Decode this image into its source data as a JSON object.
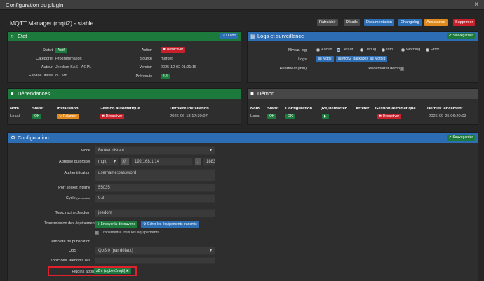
{
  "window": {
    "title": "Configuration du plugin",
    "close": "×"
  },
  "page_title": "MQTT Manager (mqtt2) - stable",
  "toolbar": [
    {
      "label": "Rafraichir",
      "color": "#4a4a4a"
    },
    {
      "label": "Détails",
      "color": "#4a4a4a"
    },
    {
      "label": "Documentation",
      "color": "#2c6db4"
    },
    {
      "label": "Changelog",
      "color": "#2c6db4"
    },
    {
      "label": "Assistance",
      "color": "#e08a1e"
    },
    {
      "label": "Supprimer",
      "color": "#c8202a"
    }
  ],
  "etat": {
    "title": "Etat",
    "open_button": "Ouvrir",
    "statut_label": "Statut",
    "statut_value": "Actif",
    "categorie_label": "Catégorie",
    "categorie_value": "Programmation",
    "auteur_label": "Auteur",
    "auteur_value": "Jeedom SAS - AGPL",
    "espace_label": "Espace utilisé",
    "espace_value": "8.7 MB",
    "action_label": "Action",
    "action_button": "Désactiver",
    "source_label": "Source",
    "source_value": "market",
    "version_label": "Version",
    "version_value": "2025-12-02 01:21:15",
    "prerequis_label": "Prérequis",
    "prerequis_value": "4.4"
  },
  "logs": {
    "title": "Logs et surveillance",
    "save": "Sauvegarder",
    "niveau_label": "Niveau log",
    "levels": [
      "Aucun",
      "Defaut",
      "Debug",
      "Info",
      "Warning",
      "Error"
    ],
    "logs_label": "Logs",
    "log_buttons": [
      "Mqtt2",
      "Mqtt2_packages",
      "Mqtt2d"
    ],
    "heartbeat_label": "Heartbeat (min)",
    "restart_label": "Redémarrer démon"
  },
  "deps": {
    "title": "Dépendances",
    "headers": [
      "Nom",
      "Statut",
      "Installation",
      "Gestion automatique",
      "Dernière installation"
    ],
    "row": {
      "nom": "Local",
      "statut": "OK",
      "install": "Relancer",
      "gestion": "Désactiver",
      "derniere": "2026-06-18 17:30:07"
    }
  },
  "demon": {
    "title": "Démon",
    "headers": [
      "Nom",
      "Statut",
      "Configuration",
      "(Re)Démarrer",
      "Arrêter",
      "Gestion automatique",
      "Dernier lancement"
    ],
    "row": {
      "nom": "Local",
      "statut": "OK",
      "config": "OK",
      "gestion": "Désactiver",
      "dernier": "2026-09-25 06:20:03"
    }
  },
  "config": {
    "title": "Configuration",
    "save": "Sauvegarder",
    "mode_label": "Mode",
    "mode_value": "Broker distant",
    "broker_label": "Adresse du broker",
    "broker_proto": "mqtt",
    "broker_sep": "://",
    "broker_host": "192.168.1.14",
    "broker_colon": ":",
    "broker_port": "1883",
    "auth_label": "Authentification",
    "auth_value": "username:password",
    "socket_label": "Port socket interne",
    "socket_value": "55035",
    "cycle_label": "Cycle",
    "cycle_unit": "(secondes)",
    "cycle_value": "0.3",
    "topic_label": "Topic racine Jeedom",
    "topic_value": "jeedom",
    "trans_label": "Transmission des équipements",
    "send_discovery": "Envoyer la découverte",
    "manage_transmitted": "Gérer les équipements transmis",
    "transmit_all": "Transmettre tous les équipements",
    "template_label": "Template de publication",
    "qos_label": "QoS",
    "qos_value": "QoS 0 (par défaut)",
    "linked_label": "Topic des Jeedoms liés",
    "plugins_label": "Plugins abonnés",
    "plugins_tag": "z2m (zigbee2mqtt)"
  }
}
